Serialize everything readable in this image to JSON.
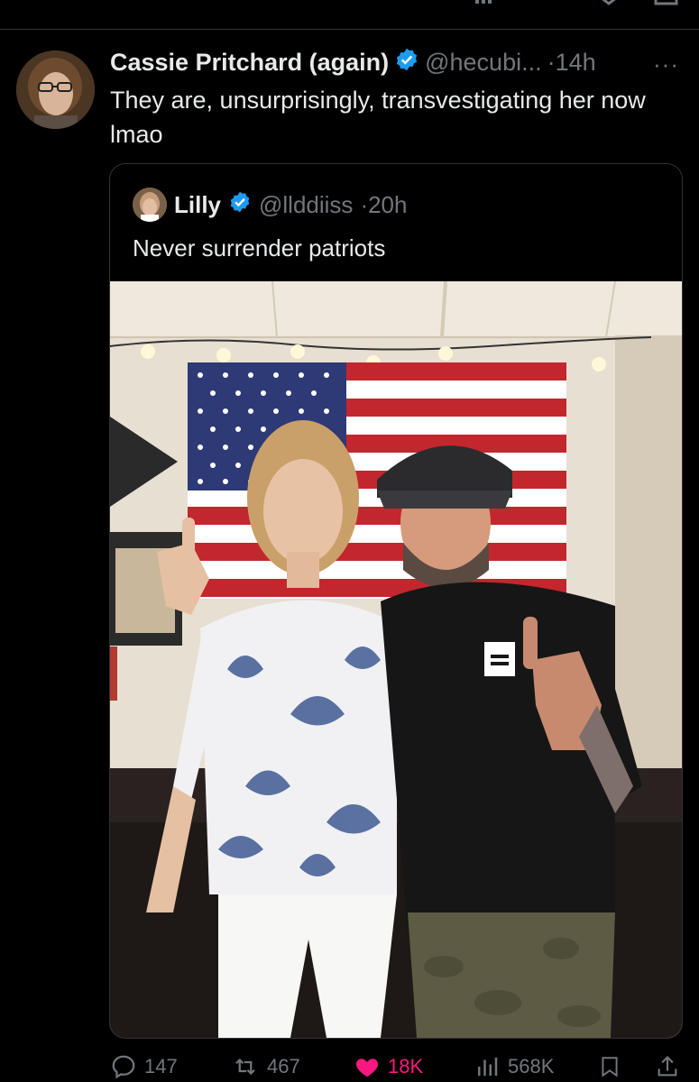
{
  "tweet": {
    "author_name": "Cassie Pritchard (again)",
    "handle": "@hecubi...",
    "time": "·14h",
    "more": "···",
    "text": "They are, unsurprisingly, transvestigating her now lmao",
    "avatar_icon": "avatar-woman-glasses"
  },
  "quoted": {
    "author_name": "Lilly",
    "handle": "@llddiiss",
    "time": "·20h",
    "text": "Never surrender patriots",
    "image_icon": "photo-two-people-flag"
  },
  "actions": {
    "replies": "147",
    "reposts": "467",
    "likes": "18K",
    "views": "568K"
  },
  "colors": {
    "background": "#000000",
    "verified": "#1d9bf0",
    "like": "#f91880",
    "muted": "#71767b"
  }
}
